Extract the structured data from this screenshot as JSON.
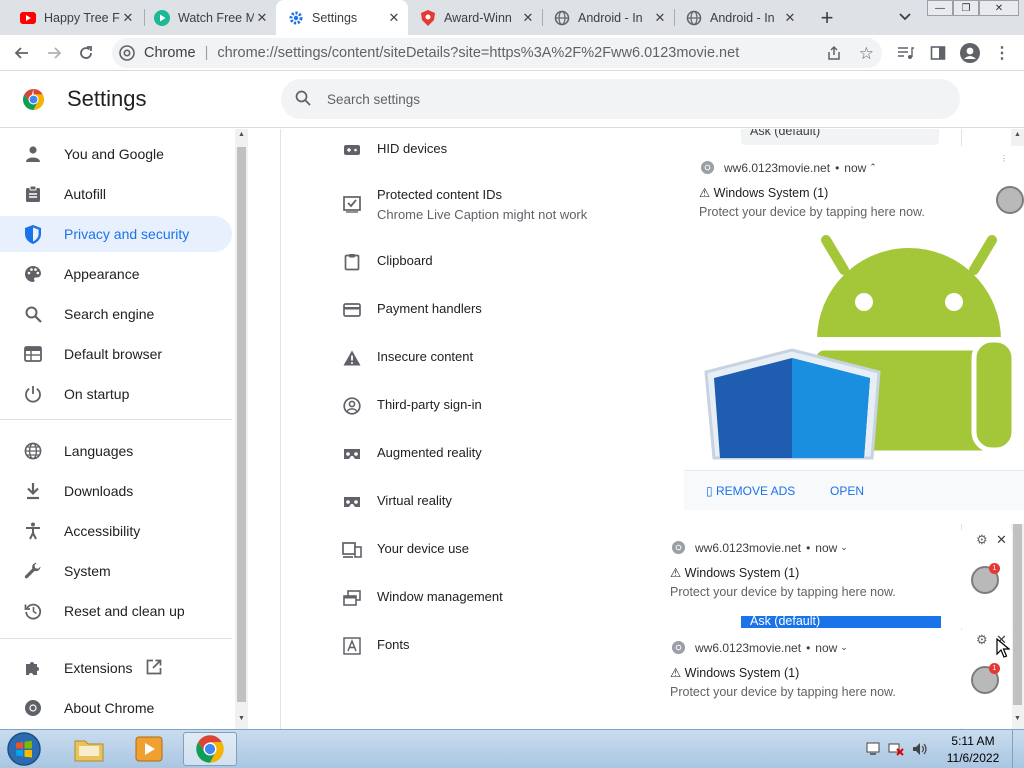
{
  "browser": {
    "tabs": [
      {
        "title": "Happy Tree F",
        "icon": "youtube-icon"
      },
      {
        "title": "Watch Free M",
        "icon": "play-icon"
      },
      {
        "title": "Settings",
        "icon": "gear-icon",
        "active": true
      },
      {
        "title": "Award-Winn",
        "icon": "shield-icon"
      },
      {
        "title": "Android - In",
        "icon": "globe-icon"
      },
      {
        "title": "Android - In",
        "icon": "globe-icon"
      }
    ],
    "omnibox": {
      "site_label": "Chrome",
      "url": "chrome://settings/content/siteDetails?site=https%3A%2F%2Fww6.0123movie.net"
    }
  },
  "settings": {
    "title": "Settings",
    "search_placeholder": "Search settings",
    "nav": [
      {
        "label": "You and Google",
        "icon": "person-icon"
      },
      {
        "label": "Autofill",
        "icon": "clipboard-icon"
      },
      {
        "label": "Privacy and security",
        "icon": "shield-icon",
        "selected": true
      },
      {
        "label": "Appearance",
        "icon": "palette-icon"
      },
      {
        "label": "Search engine",
        "icon": "search-icon"
      },
      {
        "label": "Default browser",
        "icon": "browser-icon"
      },
      {
        "label": "On startup",
        "icon": "power-icon"
      },
      {
        "label": "Languages",
        "icon": "globe-icon"
      },
      {
        "label": "Downloads",
        "icon": "download-icon"
      },
      {
        "label": "Accessibility",
        "icon": "accessibility-icon"
      },
      {
        "label": "System",
        "icon": "wrench-icon"
      },
      {
        "label": "Reset and clean up",
        "icon": "reset-icon"
      },
      {
        "label": "Extensions",
        "icon": "puzzle-icon"
      },
      {
        "label": "About Chrome",
        "icon": "chrome-icon"
      }
    ],
    "permissions": [
      {
        "label": "HID devices",
        "icon": "gamepad-icon"
      },
      {
        "label": "Protected content IDs",
        "sub": "Chrome Live Caption might not work",
        "icon": "checkbox-icon"
      },
      {
        "label": "Clipboard",
        "icon": "clipboard-icon"
      },
      {
        "label": "Payment handlers",
        "icon": "card-icon"
      },
      {
        "label": "Insecure content",
        "icon": "warning-icon"
      },
      {
        "label": "Third-party sign-in",
        "icon": "account-icon"
      },
      {
        "label": "Augmented reality",
        "icon": "vr-icon"
      },
      {
        "label": "Virtual reality",
        "icon": "vr-icon"
      },
      {
        "label": "Your device use",
        "icon": "devices-icon"
      },
      {
        "label": "Window management",
        "icon": "window-icon"
      },
      {
        "label": "Fonts",
        "icon": "font-icon"
      }
    ],
    "select_top_text": "Ask (default)",
    "select_text": "Ask (default)"
  },
  "notifications": {
    "source": "ww6.0123movie.net",
    "time": "now",
    "title": "⚠ Windows System (1)",
    "body": "Protect your device by tapping here now.",
    "actions": [
      "REMOVE ADS",
      "OPEN"
    ],
    "badge_count": "1"
  },
  "taskbar": {
    "time": "5:11 AM",
    "date": "11/6/2022"
  }
}
